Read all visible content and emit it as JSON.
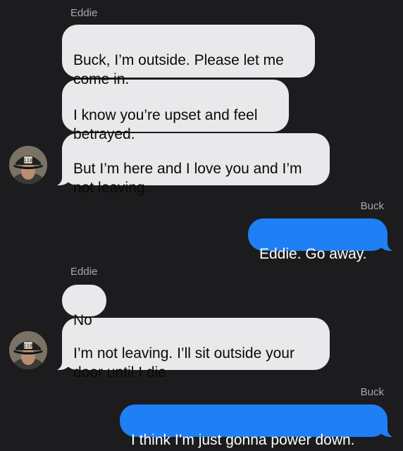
{
  "conversation": {
    "groups": [
      {
        "sender": "Eddie",
        "direction": "incoming",
        "messages": [
          "Buck, I’m outside. Please let me\ncome in.",
          "I know you’re upset and feel\nbetrayed.",
          "But I’m here and I love you and I’m\nnot leaving."
        ],
        "avatar_icon": "firefighter-helmet-avatar"
      },
      {
        "sender": "Buck",
        "direction": "outgoing",
        "messages": [
          "Eddie. Go away."
        ]
      },
      {
        "sender": "Eddie",
        "direction": "incoming",
        "messages": [
          "No",
          "I’m not leaving. I’ll sit outside your\ndoor until I die."
        ],
        "avatar_icon": "firefighter-helmet-avatar"
      },
      {
        "sender": "Buck",
        "direction": "outgoing",
        "messages": [
          "I think I’m just gonna power down."
        ]
      }
    ]
  },
  "colors": {
    "background": "#1c1c1e",
    "incoming_bubble": "#e9e9eb",
    "outgoing_bubble": "#1f7ff5",
    "sender_label": "#a8a8ad"
  }
}
